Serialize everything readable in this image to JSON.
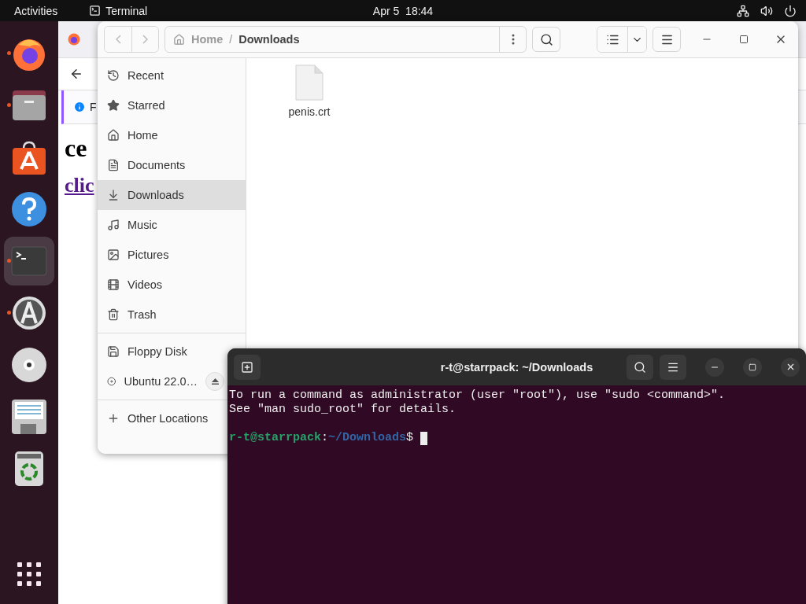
{
  "top_bar": {
    "activities": "Activities",
    "app_name": "Terminal",
    "clock": "Apr 5  18:44"
  },
  "dock": [
    {
      "kind": "firefox",
      "running": true,
      "selected": false
    },
    {
      "kind": "files",
      "running": true,
      "selected": false
    },
    {
      "kind": "store",
      "running": false,
      "selected": false
    },
    {
      "kind": "help",
      "running": false,
      "selected": false
    },
    {
      "kind": "terminal",
      "running": true,
      "selected": true
    },
    {
      "kind": "updater",
      "running": true,
      "selected": false
    },
    {
      "kind": "disc",
      "running": false,
      "selected": false
    },
    {
      "kind": "floppy",
      "running": false,
      "selected": false
    },
    {
      "kind": "trash",
      "running": false,
      "selected": false
    }
  ],
  "browser": {
    "notice": "F",
    "heading": "ce",
    "link": "clic"
  },
  "files": {
    "path": [
      "Home",
      "Downloads"
    ],
    "path_separator": "/",
    "places": [
      {
        "label": "Recent",
        "kind": "recent",
        "selected": false
      },
      {
        "label": "Starred",
        "kind": "starred",
        "selected": false
      },
      {
        "label": "Home",
        "kind": "home",
        "selected": false
      },
      {
        "label": "Documents",
        "kind": "documents",
        "selected": false
      },
      {
        "label": "Downloads",
        "kind": "downloads",
        "selected": true
      },
      {
        "label": "Music",
        "kind": "music",
        "selected": false
      },
      {
        "label": "Pictures",
        "kind": "pictures",
        "selected": false
      },
      {
        "label": "Videos",
        "kind": "videos",
        "selected": false
      },
      {
        "label": "Trash",
        "kind": "trash",
        "selected": false
      }
    ],
    "devices": [
      {
        "label": "Floppy Disk",
        "kind": "floppy",
        "eject": false
      },
      {
        "label": "Ubuntu 22.0…",
        "kind": "disc",
        "eject": true
      }
    ],
    "other": "Other Locations",
    "items": [
      {
        "name": "penis.crt"
      }
    ]
  },
  "terminal": {
    "title": "r-t@starrpack: ~/Downloads",
    "lines": [
      "To run a command as administrator (user \"root\"), use \"sudo <command>\".",
      "See \"man sudo_root\" for details."
    ],
    "prompt": {
      "user": "r-t@starrpack",
      "separator": ":",
      "path": "~/Downloads",
      "symbol": "$"
    }
  }
}
